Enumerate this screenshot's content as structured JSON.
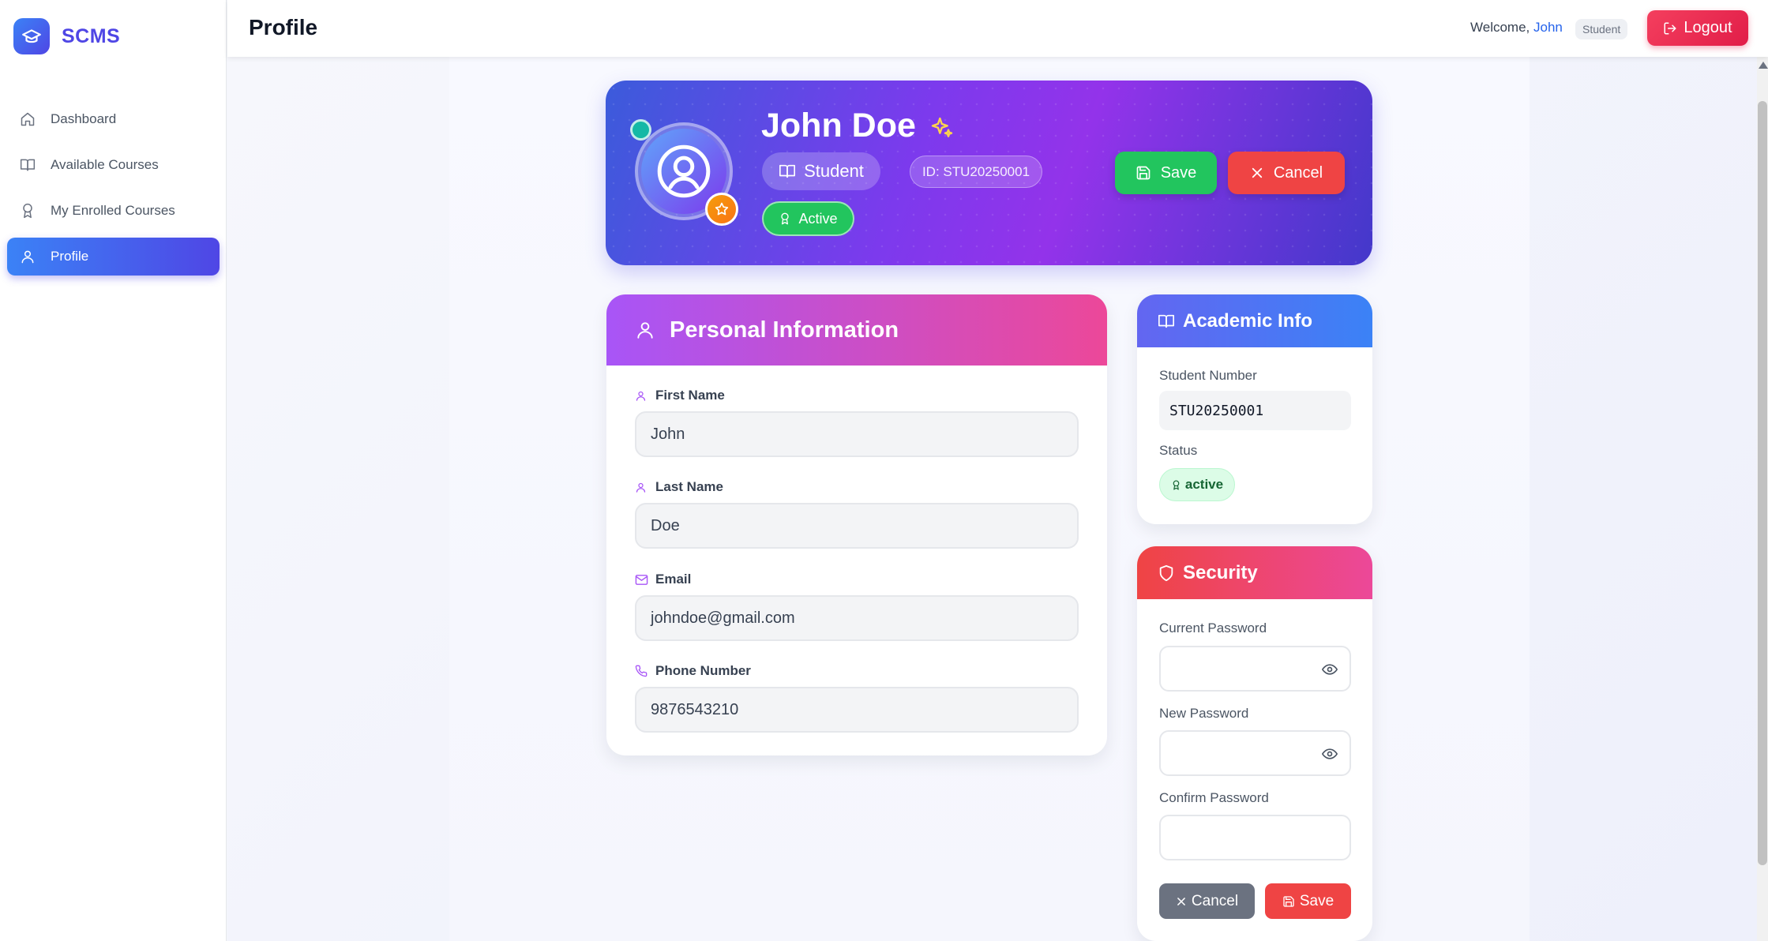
{
  "app": {
    "name": "SCMS"
  },
  "sidebar": {
    "items": [
      {
        "label": "Dashboard",
        "icon": "home-icon",
        "active": false
      },
      {
        "label": "Available Courses",
        "icon": "book-open-icon",
        "active": false
      },
      {
        "label": "My Enrolled Courses",
        "icon": "award-icon",
        "active": false
      },
      {
        "label": "Profile",
        "icon": "user-icon",
        "active": true
      }
    ]
  },
  "header": {
    "title": "Profile",
    "welcome_prefix": "Welcome, ",
    "user_first_name": "John",
    "role": "Student",
    "logout_label": "Logout"
  },
  "hero": {
    "full_name": "John Doe",
    "role_label": "Student",
    "id_label": "ID: STU20250001",
    "status_label": "Active",
    "save_label": "Save",
    "cancel_label": "Cancel"
  },
  "personal": {
    "title": "Personal Information",
    "fields": [
      {
        "label": "First Name",
        "value": "John",
        "icon": "user-icon"
      },
      {
        "label": "Last Name",
        "value": "Doe",
        "icon": "user-icon"
      },
      {
        "label": "Email",
        "value": "johndoe@gmail.com",
        "icon": "mail-icon"
      },
      {
        "label": "Phone Number",
        "value": "9876543210",
        "icon": "phone-icon"
      }
    ]
  },
  "academic": {
    "title": "Academic Info",
    "student_number_label": "Student Number",
    "student_number": "STU20250001",
    "status_label": "Status",
    "status_value": "active"
  },
  "security": {
    "title": "Security",
    "current_password_label": "Current Password",
    "new_password_label": "New Password",
    "confirm_password_label": "Confirm Password",
    "cancel_label": "Cancel",
    "save_label": "Save"
  },
  "colors": {
    "accent": "#4f46e5",
    "logout": "#e11d48",
    "success": "#22c55e",
    "danger": "#ef4444",
    "personal_gradient": [
      "#a855f7",
      "#ec4899"
    ],
    "academic_gradient": [
      "#6366f1",
      "#3b82f6"
    ],
    "security_gradient": [
      "#ef4444",
      "#ec4899"
    ]
  }
}
